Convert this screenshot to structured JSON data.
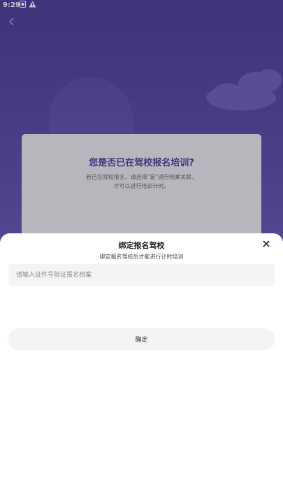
{
  "status_bar": {
    "time": "9:29",
    "icons": [
      "notification-icon",
      "warning-icon"
    ]
  },
  "background_card": {
    "question": "您是否已在驾校报名培训?",
    "description_line1": "若已在驾校报名，请选择\"是\"进行档案关联，",
    "description_line2": "才可以进行培训计时。"
  },
  "bottom_sheet": {
    "title": "绑定报名驾校",
    "subtitle": "绑定报名驾校后才能进行计时培训",
    "id_input": {
      "value": "",
      "placeholder": "请输入证件号验证报名档案"
    },
    "confirm_label": "确定"
  },
  "colors": {
    "background_purple": "#4b3e8e",
    "card_title_purple": "#3e3680",
    "sheet_white": "#ffffff",
    "field_gray": "#f4f4f5"
  }
}
